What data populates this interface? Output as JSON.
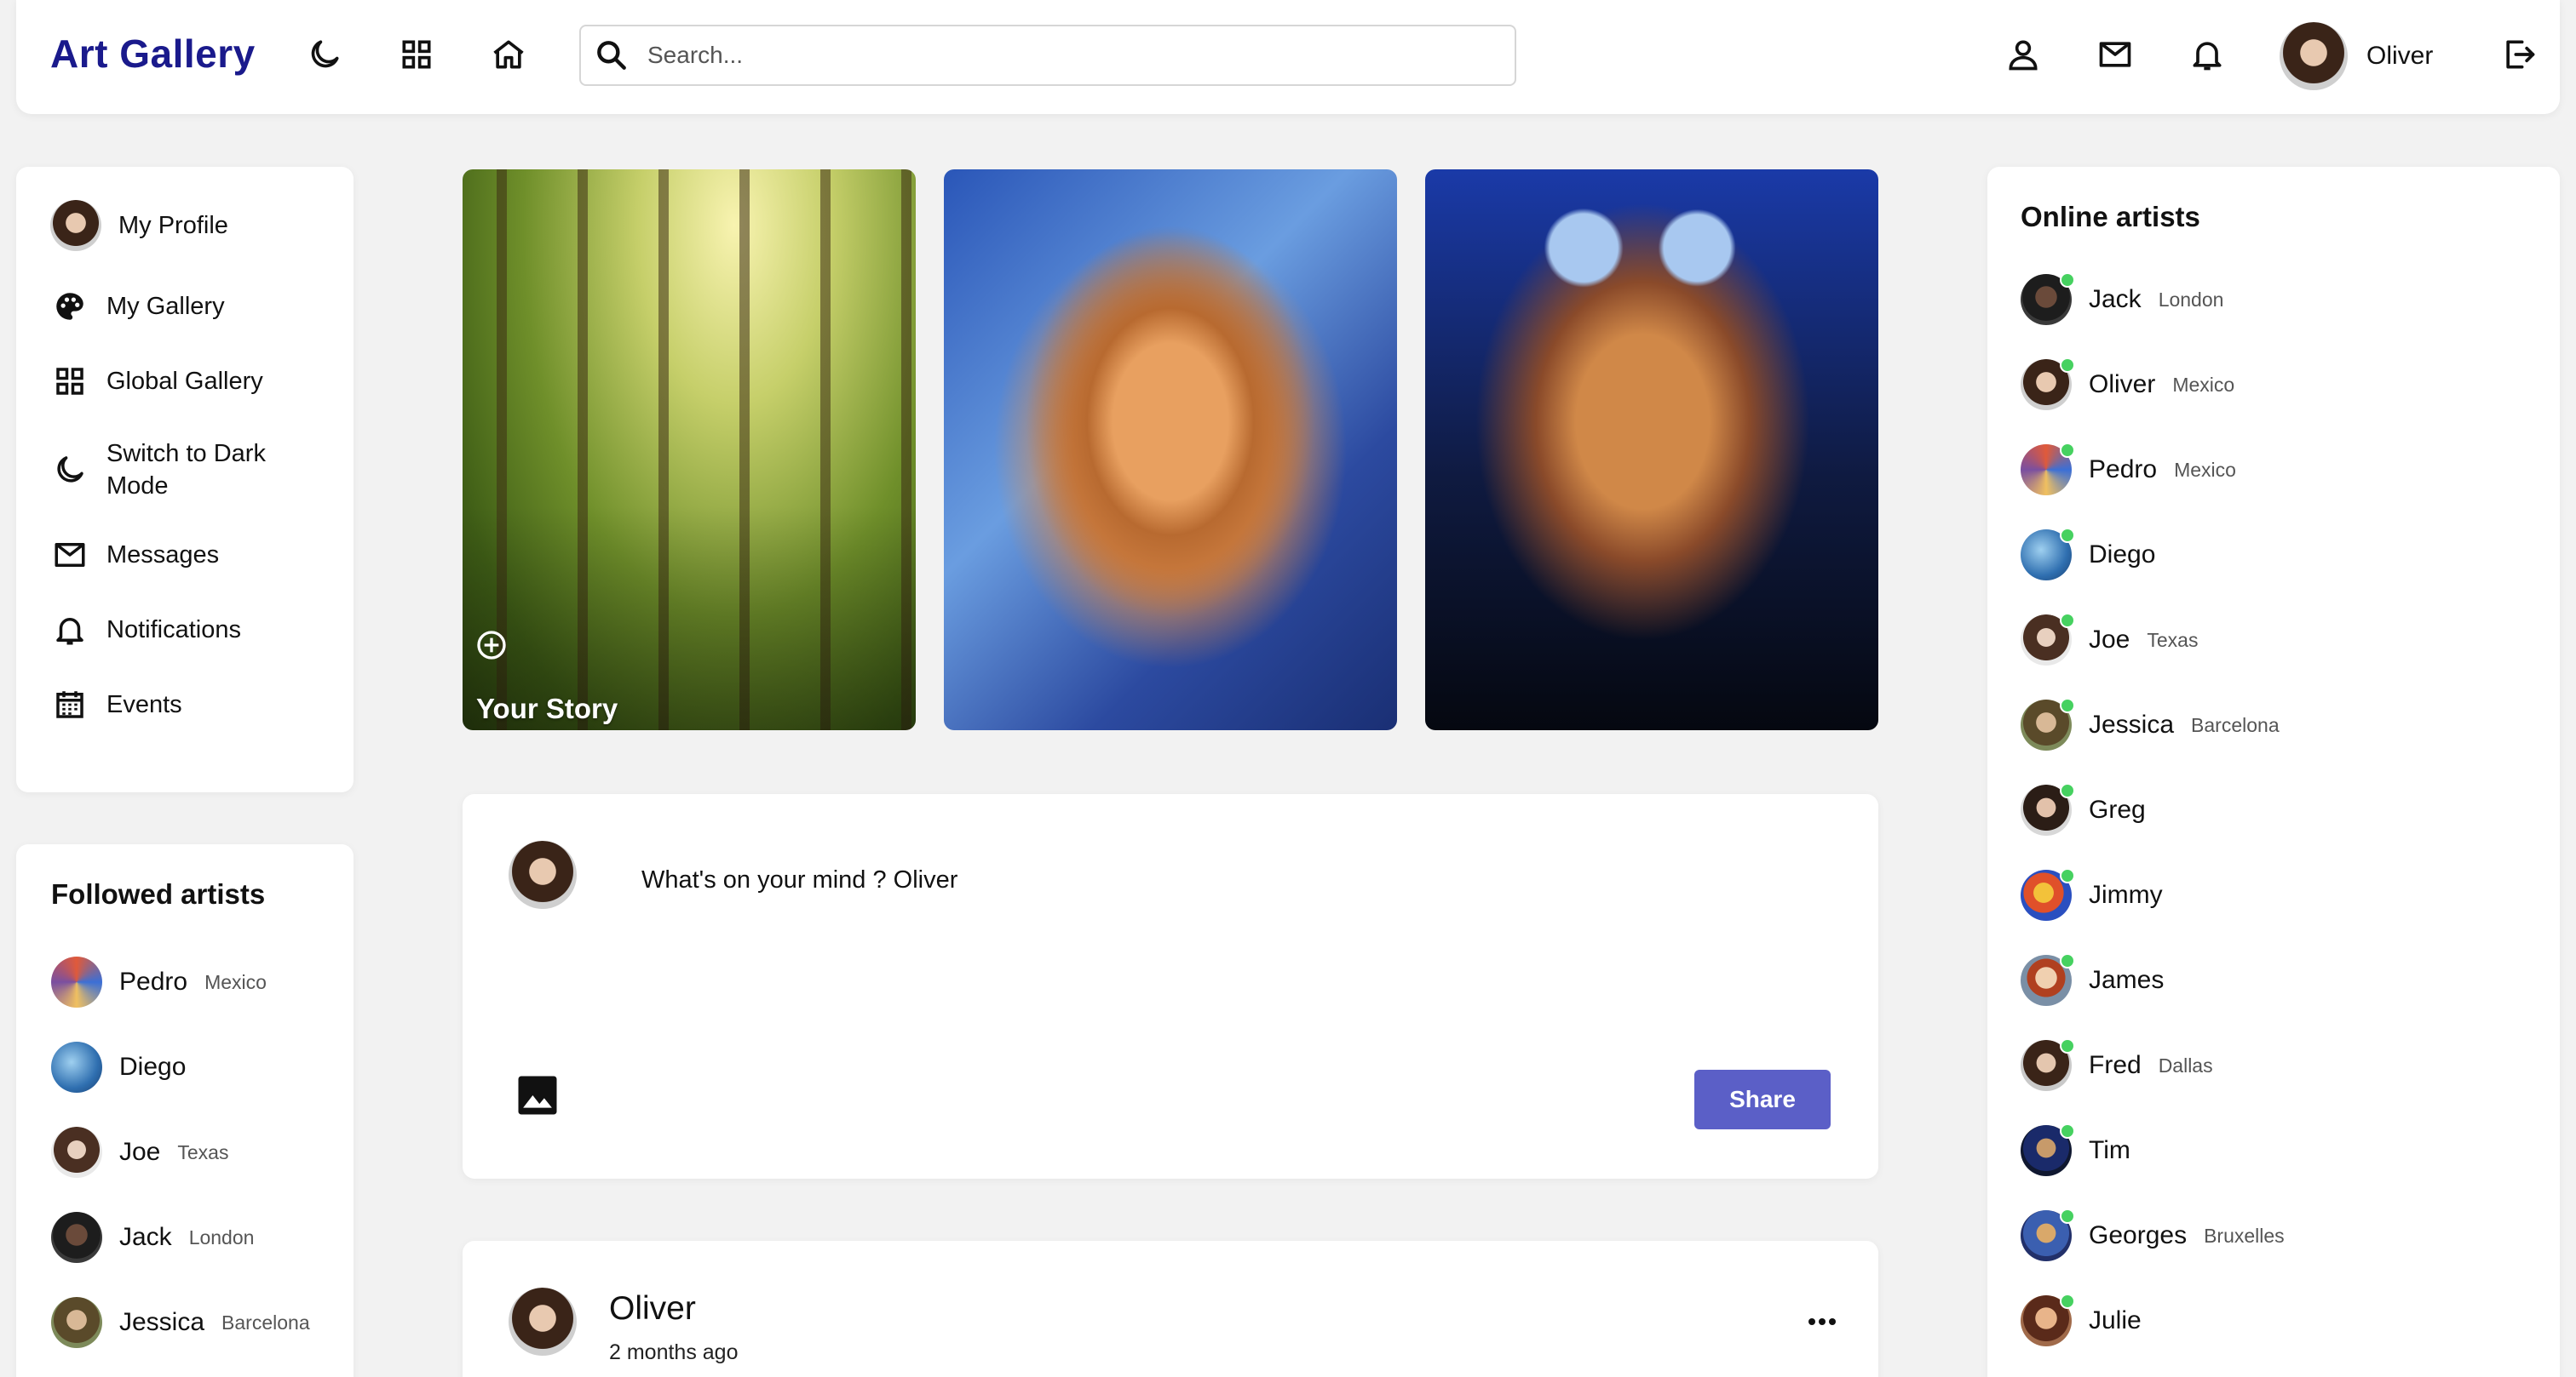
{
  "app": {
    "title": "Art Gallery"
  },
  "header": {
    "search_placeholder": "Search...",
    "user_name": "Oliver",
    "icons": [
      "moon-icon",
      "grid-icon",
      "home-icon",
      "person-icon",
      "mail-icon",
      "bell-icon",
      "logout-icon"
    ]
  },
  "sidebar": {
    "items": [
      {
        "label": "My Profile",
        "icon": "avatar"
      },
      {
        "label": "My Gallery",
        "icon": "palette-icon"
      },
      {
        "label": "Global Gallery",
        "icon": "grid-icon"
      },
      {
        "label": "Switch to Dark Mode",
        "icon": "moon-icon"
      },
      {
        "label": "Messages",
        "icon": "mail-icon"
      },
      {
        "label": "Notifications",
        "icon": "bell-icon"
      },
      {
        "label": "Events",
        "icon": "calendar-icon"
      }
    ]
  },
  "followed": {
    "title": "Followed artists",
    "artists": [
      {
        "name": "Pedro",
        "location": "Mexico"
      },
      {
        "name": "Diego",
        "location": ""
      },
      {
        "name": "Joe",
        "location": "Texas"
      },
      {
        "name": "Jack",
        "location": "London"
      },
      {
        "name": "Jessica",
        "location": "Barcelona"
      }
    ]
  },
  "stories": {
    "your_story_label": "Your Story"
  },
  "composer": {
    "placeholder": "What's on your mind ? Oliver",
    "share_label": "Share"
  },
  "post": {
    "author": "Oliver",
    "time": "2 months ago"
  },
  "online": {
    "title": "Online artists",
    "artists": [
      {
        "name": "Jack",
        "location": "London"
      },
      {
        "name": "Oliver",
        "location": "Mexico"
      },
      {
        "name": "Pedro",
        "location": "Mexico"
      },
      {
        "name": "Diego",
        "location": ""
      },
      {
        "name": "Joe",
        "location": "Texas"
      },
      {
        "name": "Jessica",
        "location": "Barcelona"
      },
      {
        "name": "Greg",
        "location": ""
      },
      {
        "name": "Jimmy",
        "location": ""
      },
      {
        "name": "James",
        "location": ""
      },
      {
        "name": "Fred",
        "location": "Dallas"
      },
      {
        "name": "Tim",
        "location": ""
      },
      {
        "name": "Georges",
        "location": "Bruxelles"
      },
      {
        "name": "Julie",
        "location": ""
      }
    ]
  },
  "colors": {
    "brand": "#1a1a8c",
    "accent": "#5b5fc7",
    "online": "#46d160"
  }
}
